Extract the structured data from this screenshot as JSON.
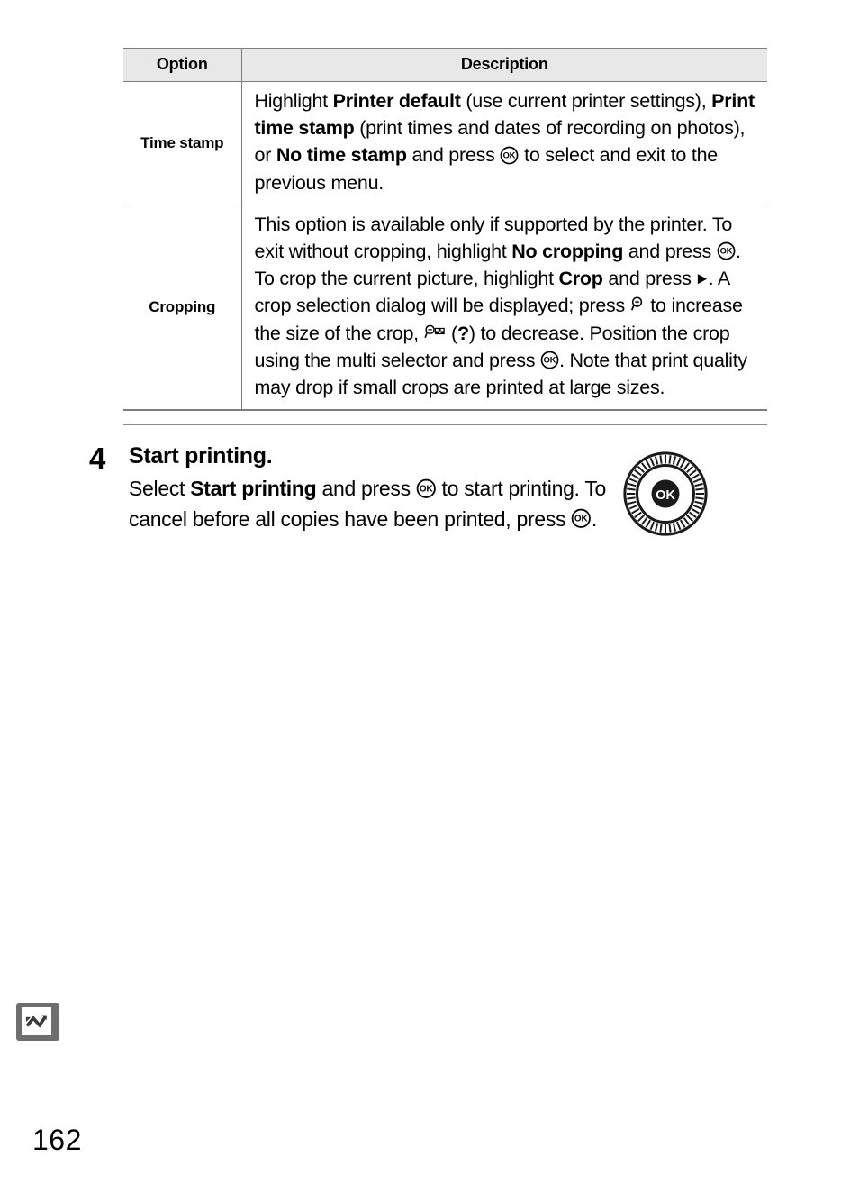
{
  "page": {
    "number": "162",
    "chapter_tab_icon": "zigzag-arrow-icon"
  },
  "table": {
    "headers": {
      "option": "Option",
      "description": "Description"
    },
    "rows": [
      {
        "option": "Time stamp",
        "description_runs": [
          {
            "t": "Highlight ",
            "b": false
          },
          {
            "t": "Printer default",
            "b": true
          },
          {
            "t": " (use current printer settings), ",
            "b": false
          },
          {
            "t": "Print time stamp",
            "b": true
          },
          {
            "t": " (print times and dates of recording on photos), or ",
            "b": false
          },
          {
            "t": "No time stamp",
            "b": true
          },
          {
            "t": " and press ",
            "b": false
          },
          {
            "t": "[ok-button-icon]",
            "b": false
          },
          {
            "t": " to select and exit to the previous menu.",
            "b": false
          }
        ]
      },
      {
        "option": "Cropping",
        "description_runs": [
          {
            "t": "This option is available only if supported by the printer.  To exit without cropping, highlight ",
            "b": false
          },
          {
            "t": "No cropping",
            "b": true
          },
          {
            "t": " and press ",
            "b": false
          },
          {
            "t": "[ok-button-icon]",
            "b": false
          },
          {
            "t": ".  To crop the current picture, highlight ",
            "b": false
          },
          {
            "t": "Crop",
            "b": true
          },
          {
            "t": " and press ",
            "b": false
          },
          {
            "t": "[right-arrow-icon]",
            "b": false
          },
          {
            "t": ".  A crop selection dialog will be displayed; press ",
            "b": false
          },
          {
            "t": "[zoom-in-icon]",
            "b": false
          },
          {
            "t": " to increase the size of the crop, ",
            "b": false
          },
          {
            "t": "[zoom-out-thumbnail-icon]",
            "b": false
          },
          {
            "t": " (",
            "b": false
          },
          {
            "t": "?",
            "b": true
          },
          {
            "t": ") to decrease.  Position the crop using the multi selector and press ",
            "b": false
          },
          {
            "t": "[ok-button-icon]",
            "b": false
          },
          {
            "t": ".  Note that print quality may drop if small crops are printed at large sizes.",
            "b": false
          }
        ]
      }
    ]
  },
  "step": {
    "number": "4",
    "title": "Start printing.",
    "text_runs": [
      {
        "t": "Select ",
        "b": false
      },
      {
        "t": "Start printing",
        "b": true
      },
      {
        "t": " and press ",
        "b": false
      },
      {
        "t": "[ok-button-icon]",
        "b": false
      },
      {
        "t": " to start printing.  To cancel before all copies have been printed, press ",
        "b": false
      },
      {
        "t": "[ok-button-icon]",
        "b": false
      },
      {
        "t": ".",
        "b": false
      }
    ],
    "illustration": {
      "name": "multi-selector-ok-dial",
      "center_label": "OK"
    }
  },
  "colors": {
    "header_fill": "#e8e8e8",
    "rule": "#7d7d7d",
    "tab_gray": "#6e6e6e",
    "text": "#000000"
  }
}
